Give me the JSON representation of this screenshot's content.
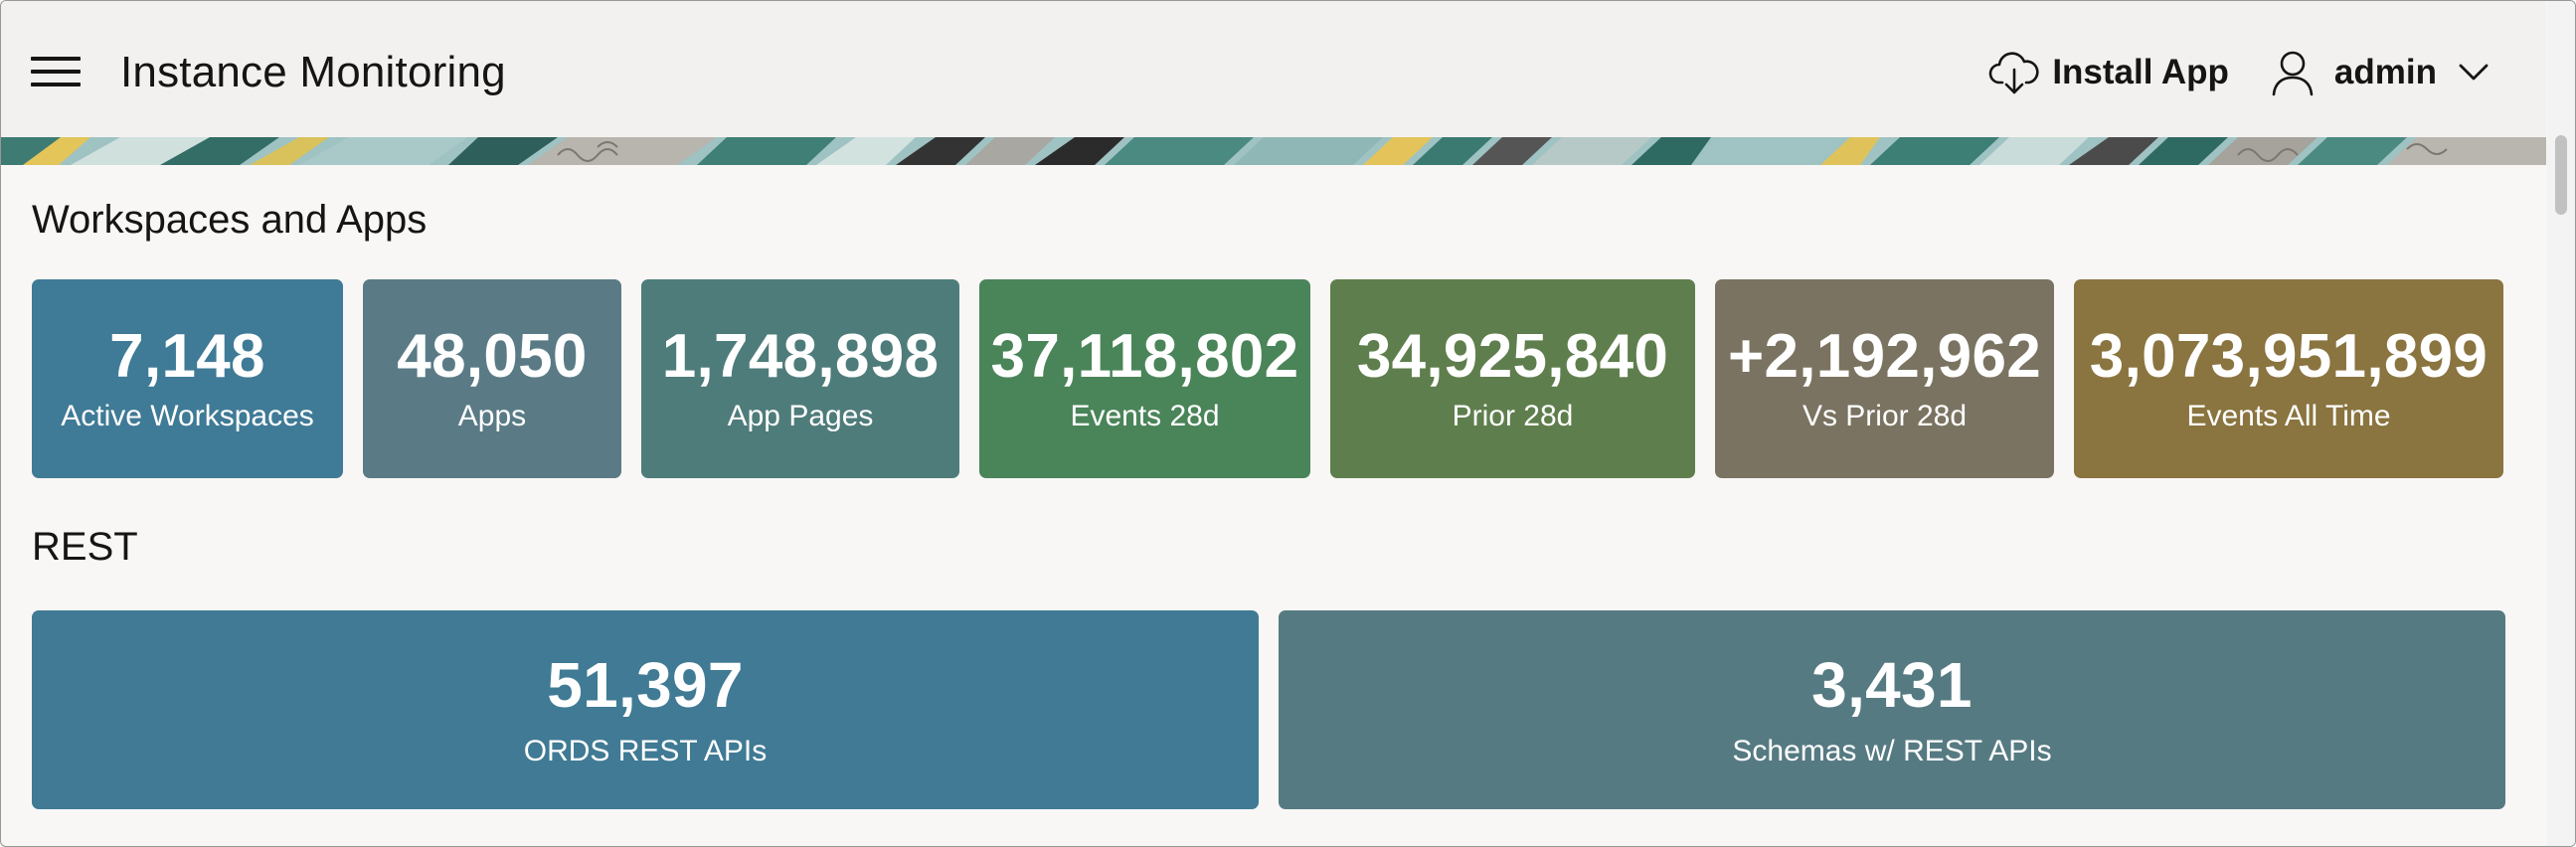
{
  "header": {
    "title": "Instance Monitoring",
    "install_label": "Install App",
    "user_label": "admin"
  },
  "sections": {
    "workspaces_title": "Workspaces and Apps",
    "rest_title": "REST"
  },
  "metrics": [
    {
      "value": "7,148",
      "label": "Active Workspaces",
      "color": "#3f7a96"
    },
    {
      "value": "48,050",
      "label": "Apps",
      "color": "#5a7b86"
    },
    {
      "value": "1,748,898",
      "label": "App Pages",
      "color": "#4e7c7a"
    },
    {
      "value": "37,118,802",
      "label": "Events 28d",
      "color": "#4a8459"
    },
    {
      "value": "34,925,840",
      "label": "Prior 28d",
      "color": "#5f7e4d"
    },
    {
      "value": "+2,192,962",
      "label": "Vs Prior 28d",
      "color": "#7a7361"
    },
    {
      "value": "3,073,951,899",
      "label": "Events All Time",
      "color": "#8a743f"
    }
  ],
  "rest_metrics": [
    {
      "value": "51,397",
      "label": "ORDS REST APIs",
      "color": "#407a94"
    },
    {
      "value": "3,431",
      "label": "Schemas w/ REST APIs",
      "color": "#567a82"
    }
  ],
  "icons": {
    "menu": "hamburger-menu-icon",
    "install": "cloud-download-icon",
    "user": "user-icon",
    "chevron": "chevron-down-icon"
  }
}
